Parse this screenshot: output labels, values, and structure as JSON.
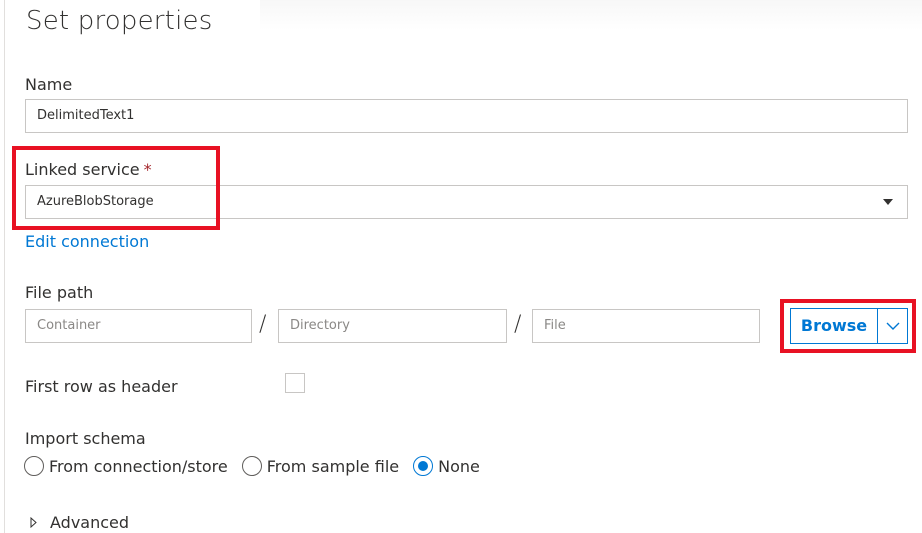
{
  "panel": {
    "title": "Set properties"
  },
  "name_field": {
    "label": "Name",
    "value": "DelimitedText1"
  },
  "linked_service": {
    "label": "Linked service",
    "required_marker": "*",
    "selected": "AzureBlobStorage",
    "edit_link": "Edit connection"
  },
  "file_path": {
    "label": "File path",
    "container_placeholder": "Container",
    "directory_placeholder": "Directory",
    "file_placeholder": "File",
    "separator": "/",
    "browse_label": "Browse"
  },
  "first_row_header": {
    "label": "First row as header",
    "checked": false
  },
  "import_schema": {
    "label": "Import schema",
    "options": [
      {
        "label": "From connection/store",
        "selected": false
      },
      {
        "label": "From sample file",
        "selected": false
      },
      {
        "label": "None",
        "selected": true
      }
    ]
  },
  "advanced": {
    "label": "Advanced"
  },
  "colors": {
    "accent": "#0078d4",
    "highlight": "#e81123",
    "required": "#a4262c"
  },
  "icons": {
    "linked_service_dropdown": "caret-down-icon",
    "browse_dropdown": "chevron-down-icon",
    "advanced": "chevron-right-icon"
  }
}
